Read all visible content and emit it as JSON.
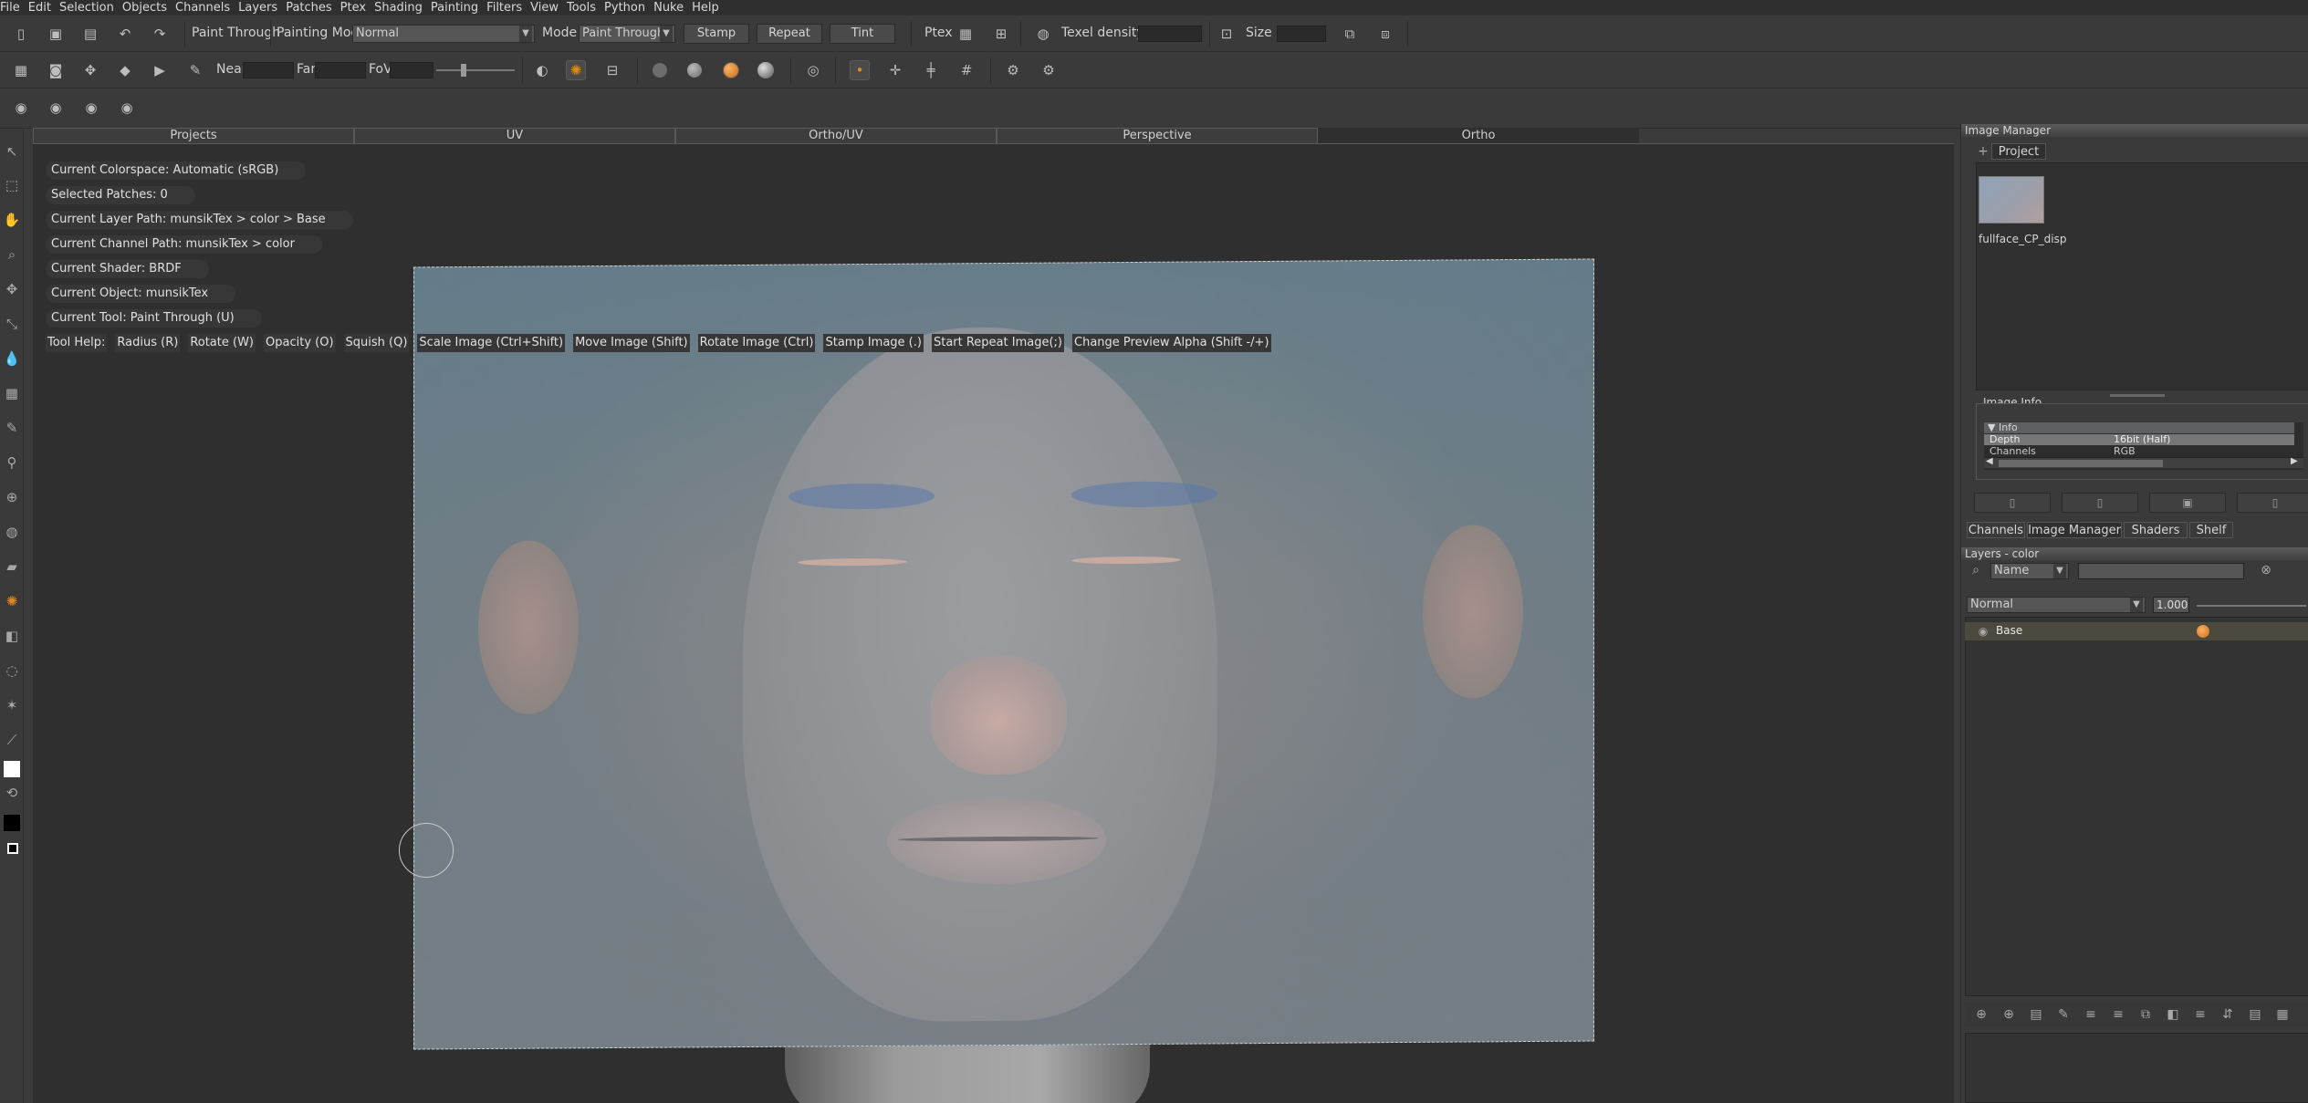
{
  "menu": [
    "File",
    "Edit",
    "Selection",
    "Objects",
    "Channels",
    "Layers",
    "Patches",
    "Ptex",
    "Shading",
    "Painting",
    "Filters",
    "View",
    "Tools",
    "Python",
    "Nuke",
    "Help"
  ],
  "toolbar1": {
    "paint_through": "Paint Through",
    "painting_mode_label": "Painting Mode",
    "painting_mode_value": "Normal",
    "mode_label": "Mode",
    "mode_value": "Paint Through",
    "stamp": "Stamp",
    "repeat": "Repeat",
    "tint": "Tint",
    "ptex": "Ptex",
    "texel_density_label": "Texel density",
    "size_label": "Size"
  },
  "toolbar2": {
    "near": "Near",
    "far": "Far",
    "fov": "FoV"
  },
  "viewport_tabs": [
    "Projects",
    "UV",
    "Ortho/UV",
    "Perspective",
    "Ortho"
  ],
  "viewport_info": {
    "colorspace": "Current Colorspace: Automatic (sRGB)",
    "selected_patches": "Selected Patches: 0",
    "layer_path": "Current Layer Path: munsikTex > color > Base",
    "channel_path": "Current Channel Path: munsikTex > color",
    "shader": "Current Shader: BRDF",
    "object": "Current Object: munsikTex",
    "tool": "Current Tool: Paint Through (U)"
  },
  "tool_help": [
    "Tool Help:",
    "Radius (R)",
    "Rotate (W)",
    "Opacity (O)",
    "Squish (Q)",
    "Scale Image (Ctrl+Shift)",
    "Move Image (Shift)",
    "Rotate Image (Ctrl)",
    "Stamp Image (.)",
    "Start Repeat Image(;)",
    "Change Preview Alpha (Shift -/+)"
  ],
  "image_manager": {
    "title": "Image Manager",
    "project_tab": "Project",
    "add_tab": "+",
    "thumb_label": "fullface_CP_disp",
    "image_info_title": "Image Info",
    "info_header": "Info",
    "rows": [
      {
        "key": "Depth",
        "value": "16bit (Half)"
      },
      {
        "key": "Channels",
        "value": "RGB"
      }
    ]
  },
  "panel_tabs": [
    "Channels",
    "Image Manager",
    "Shaders",
    "Shelf"
  ],
  "layers": {
    "title": "Layers - color",
    "filter_dropdown": "Name",
    "blend_mode": "Normal",
    "opacity": "1.000",
    "items": [
      {
        "name": "Base"
      }
    ]
  },
  "colors": {
    "accent": "#e0871f",
    "background": "#3b3b3b",
    "viewport": "#2f2f2f"
  }
}
